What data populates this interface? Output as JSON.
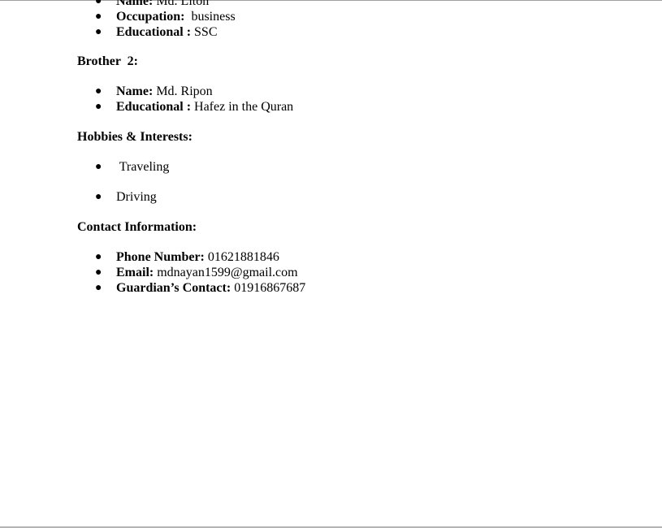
{
  "sections": {
    "brother1": {
      "items": [
        {
          "label": "Name:",
          "value": " Md. Liton"
        },
        {
          "label": "Occupation:",
          "value": "  business"
        },
        {
          "label": "Educational :",
          "value": " SSC"
        }
      ]
    },
    "brother2": {
      "heading": "Brother  2:",
      "items": [
        {
          "label": "Name:",
          "value": " Md. Ripon"
        },
        {
          "label": "Educational :",
          "value": " Hafez in the Quran"
        }
      ]
    },
    "hobbies": {
      "heading": "Hobbies & Interests:",
      "items": [
        {
          "value": " Traveling"
        },
        {
          "value": "Driving"
        }
      ]
    },
    "contact": {
      "heading": "Contact Information:",
      "items": [
        {
          "label": "Phone Number:",
          "value": " 01621881846"
        },
        {
          "label": "Email:",
          "value": " mdnayan1599@gmail.com"
        },
        {
          "label": "Guardian’s Contact:",
          "value": " 01916867687"
        }
      ]
    }
  },
  "bullet_glyph": "●"
}
